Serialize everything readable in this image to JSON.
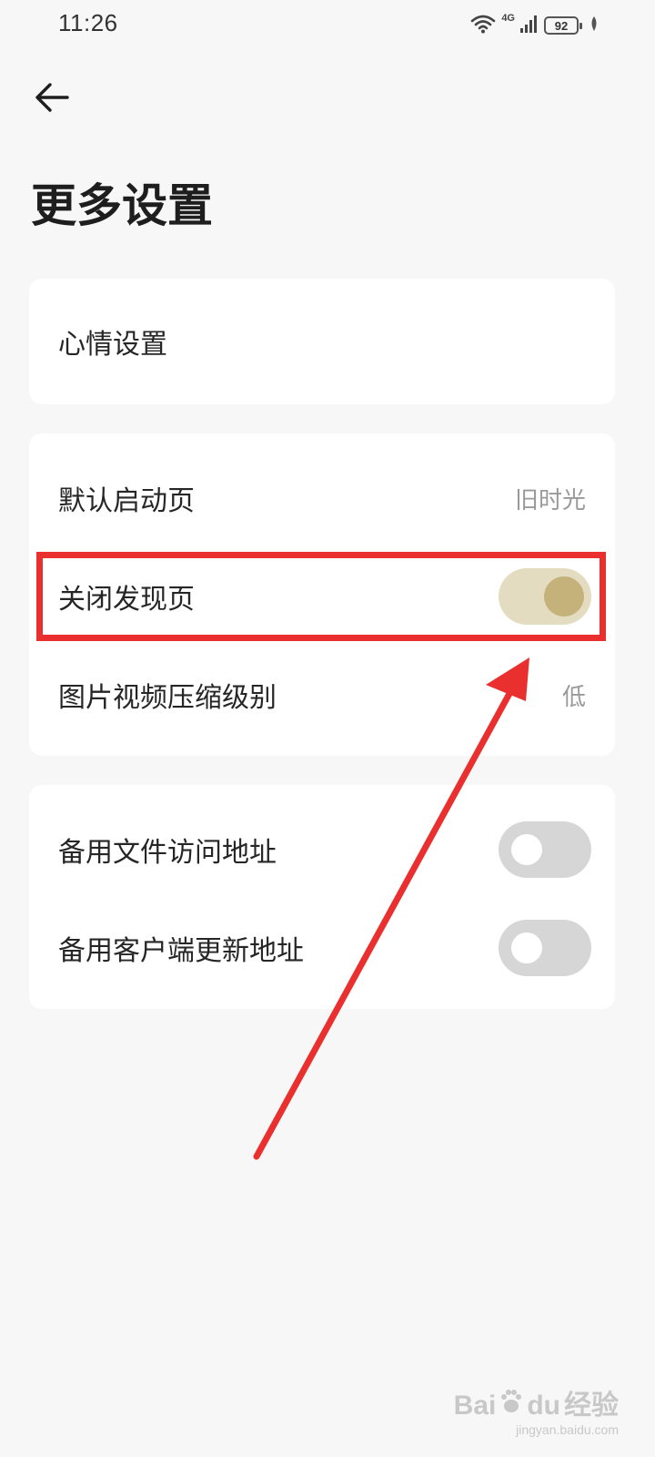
{
  "status_bar": {
    "time": "11:26",
    "network": "4G",
    "battery": "92"
  },
  "page": {
    "title": "更多设置"
  },
  "groups": [
    {
      "items": [
        {
          "label": "心情设置"
        }
      ]
    },
    {
      "items": [
        {
          "label": "默认启动页",
          "value": "旧时光"
        },
        {
          "label": "关闭发现页",
          "toggle": true
        },
        {
          "label": "图片视频压缩级别",
          "value": "低"
        }
      ]
    },
    {
      "items": [
        {
          "label": "备用文件访问地址",
          "toggle": false
        },
        {
          "label": "备用客户端更新地址",
          "toggle": false
        }
      ]
    }
  ],
  "annotation": {
    "highlight_color": "#ea2f2f"
  },
  "colors": {
    "toggle_on_track": "#e4dcc1",
    "toggle_on_knob": "#c4b27a",
    "toggle_off_track": "#d6d6d6"
  },
  "watermark": {
    "brand": "Bai",
    "brand_suffix": "du",
    "cn": "经验",
    "url": "jingyan.baidu.com"
  }
}
